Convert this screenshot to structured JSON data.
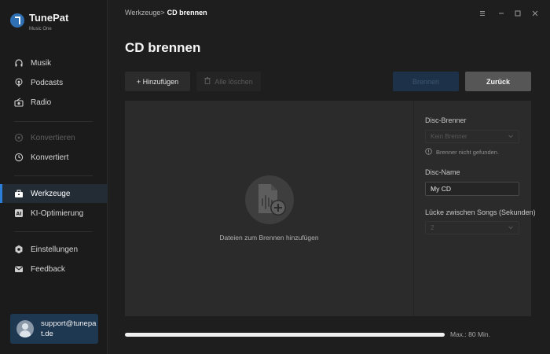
{
  "app": {
    "name": "TunePat",
    "subtitle": "Music One"
  },
  "sidebar": {
    "items": [
      {
        "label": "Musik",
        "icon": "headphones-icon",
        "state": "normal"
      },
      {
        "label": "Podcasts",
        "icon": "podcast-icon",
        "state": "normal"
      },
      {
        "label": "Radio",
        "icon": "radio-icon",
        "state": "normal"
      },
      {
        "label": "Konvertieren",
        "icon": "convert-icon",
        "state": "disabled"
      },
      {
        "label": "Konvertiert",
        "icon": "clock-icon",
        "state": "normal"
      },
      {
        "label": "Werkzeuge",
        "icon": "toolbox-icon",
        "state": "active"
      },
      {
        "label": "KI-Optimierung",
        "icon": "ai-icon",
        "state": "normal"
      },
      {
        "label": "Einstellungen",
        "icon": "gear-icon",
        "state": "normal"
      },
      {
        "label": "Feedback",
        "icon": "mail-icon",
        "state": "normal"
      }
    ],
    "user": {
      "email": "support@tunepat.de"
    }
  },
  "header": {
    "breadcrumb": {
      "parent": "Werkzeuge",
      "separator": ">",
      "current": "CD brennen"
    },
    "window_controls": [
      "menu-icon",
      "minimize-icon",
      "maximize-icon",
      "close-icon"
    ]
  },
  "page": {
    "title": "CD brennen",
    "buttons": {
      "add": "+ Hinzufügen",
      "clear": "Alle löschen",
      "burn": "Brennen",
      "back": "Zurück"
    },
    "dropzone": {
      "label": "Dateien zum Brennen hinzufügen"
    },
    "form": {
      "burner_label": "Disc-Brenner",
      "burner_value": "Kein Brenner",
      "burner_warning": "Brenner nicht gefunden.",
      "disc_name_label": "Disc-Name",
      "disc_name_value": "My CD",
      "gap_label": "Lücke zwischen Songs (Sekunden)",
      "gap_value": "2"
    },
    "capacity": {
      "used_fraction": 1.0,
      "max_label": "Max.: 80 Min."
    }
  },
  "colors": {
    "accent": "#2b7fd8",
    "sidebar_active_bg": "#232b35",
    "user_box_bg": "#1f3852",
    "back_button_bg": "#565656"
  }
}
